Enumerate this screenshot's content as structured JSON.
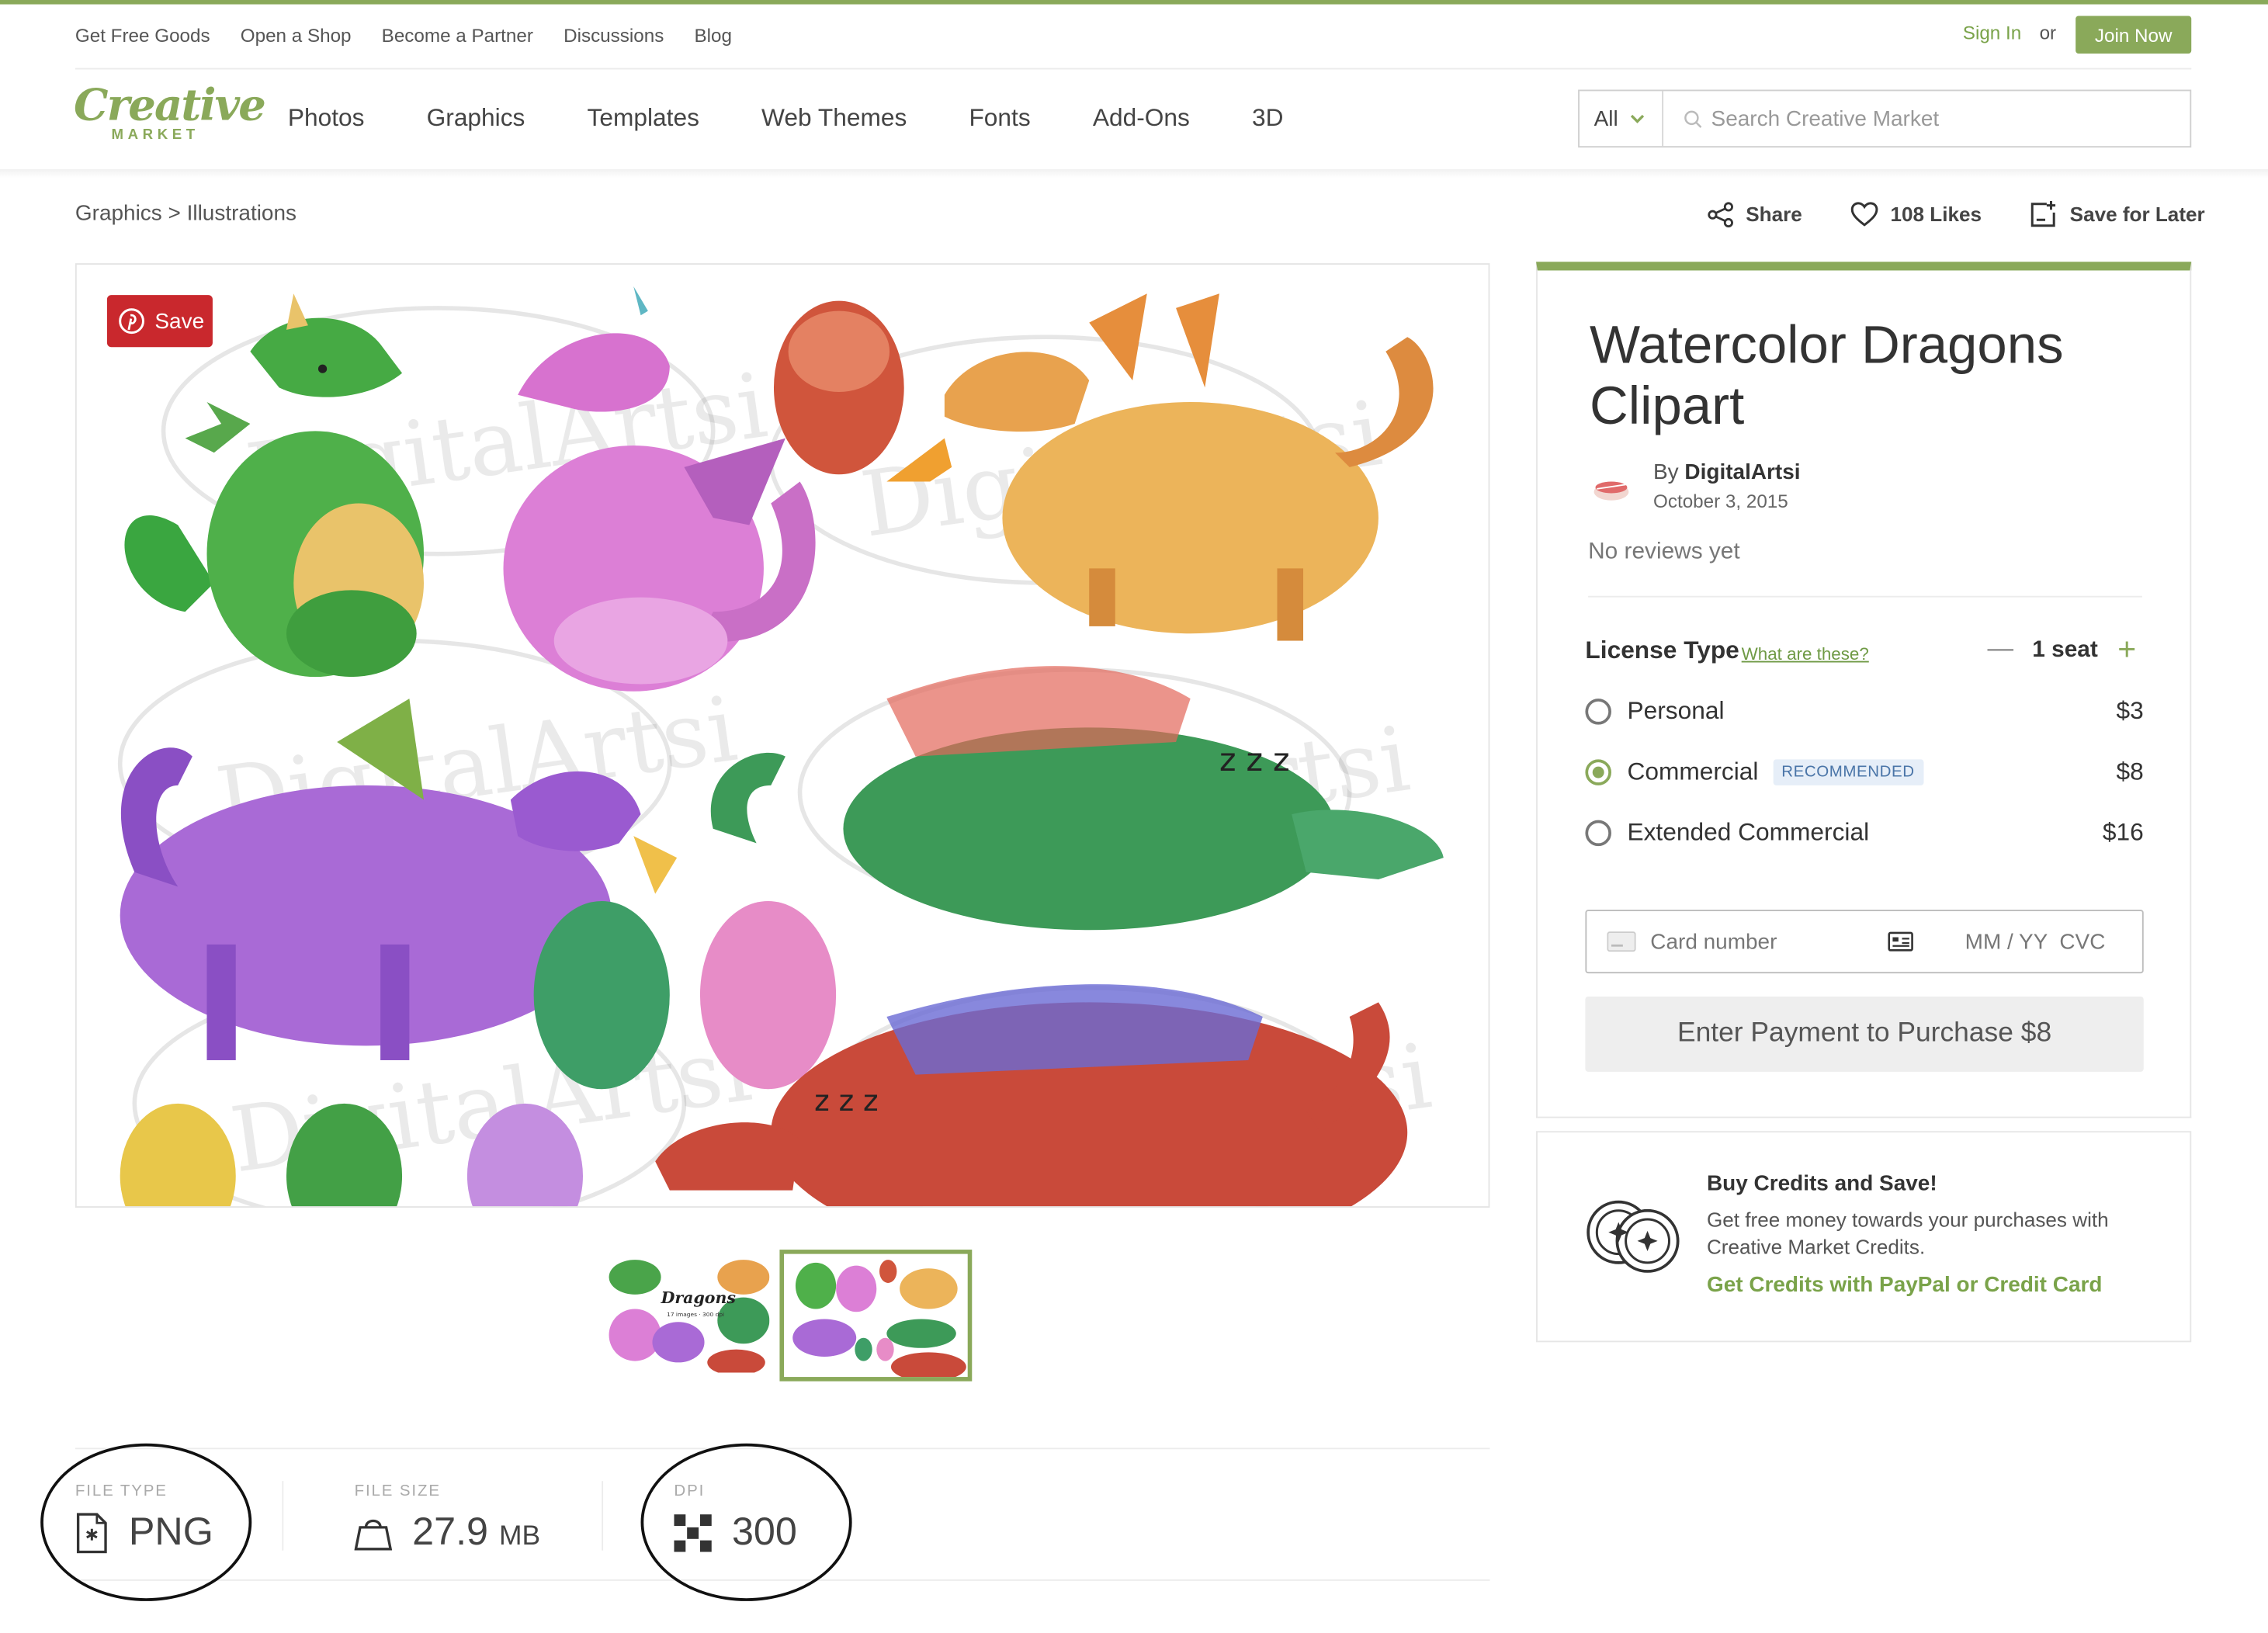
{
  "utility_nav": {
    "items": [
      "Get Free Goods",
      "Open a Shop",
      "Become a Partner",
      "Discussions",
      "Blog"
    ],
    "sign_in": "Sign In",
    "or": "or",
    "join": "Join Now"
  },
  "logo": {
    "main": "Creative",
    "sub": "MARKET"
  },
  "main_nav": [
    "Photos",
    "Graphics",
    "Templates",
    "Web Themes",
    "Fonts",
    "Add-Ons",
    "3D"
  ],
  "search": {
    "category": "All",
    "placeholder": "Search Creative Market"
  },
  "breadcrumb": "Graphics > Illustrations",
  "actions": {
    "share": "Share",
    "likes": "108 Likes",
    "save_later": "Save for Later"
  },
  "pinterest": {
    "label": "Save"
  },
  "product": {
    "title": "Watercolor Dragons Clipart",
    "by": "By",
    "author": "DigitalArtsi",
    "date": "October 3, 2015",
    "reviews": "No reviews yet"
  },
  "license": {
    "label": "License Type",
    "help_link": "What are these?",
    "seat_minus": "—",
    "seats": "1 seat",
    "seat_plus": "+",
    "options": [
      {
        "name": "Personal",
        "price": "$3",
        "selected": false
      },
      {
        "name": "Commercial",
        "price": "$8",
        "selected": true,
        "badge": "RECOMMENDED"
      },
      {
        "name": "Extended Commercial",
        "price": "$16",
        "selected": false
      }
    ]
  },
  "payment": {
    "card_placeholder": "Card number",
    "expiry_cvc": "MM / YY  CVC",
    "button": "Enter Payment to Purchase $8"
  },
  "credits": {
    "title": "Buy Credits and Save!",
    "text": "Get free money towards your purchases with Creative Market Credits.",
    "link": "Get Credits with PayPal or Credit Card"
  },
  "file_info": {
    "type_label": "FILE TYPE",
    "type_value": "PNG",
    "size_label": "FILE SIZE",
    "size_value": "27.9",
    "size_unit": "MB",
    "dpi_label": "DPI",
    "dpi_value": "300"
  },
  "thumbnail_text": {
    "title": "Dragons",
    "subtitle": "17 images · 300 dpi"
  },
  "watermark": "DigitalArtsi",
  "colors": {
    "accent": "#8aa95a",
    "pinterest": "#c9282d",
    "link": "#7aa34a"
  }
}
